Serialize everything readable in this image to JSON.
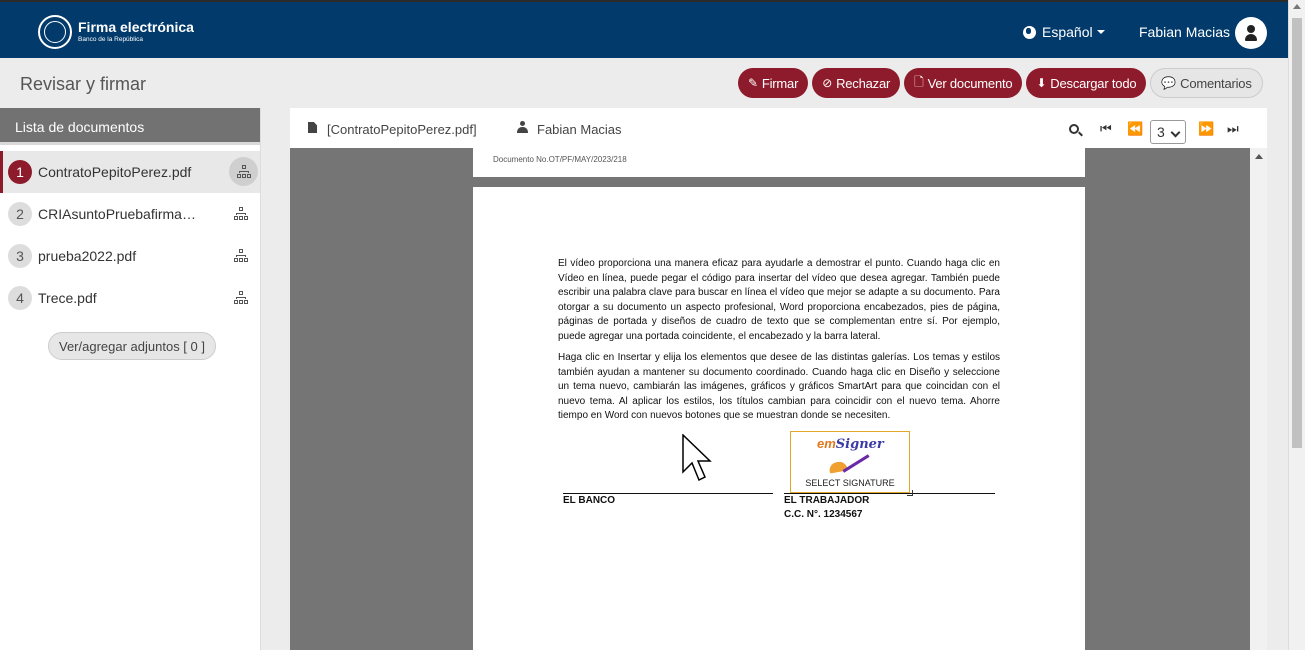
{
  "app": {
    "title": "Firma electrónica",
    "subtitle": "Banco de la República",
    "language": "Español",
    "user": "Fabian Macias"
  },
  "page": {
    "title": "Revisar y firmar"
  },
  "actions": {
    "sign": "Firmar",
    "reject": "Rechazar",
    "view": "Ver documento",
    "download": "Descargar todo",
    "comments": "Comentarios"
  },
  "sidebar": {
    "header": "Lista de documentos",
    "documents": [
      {
        "num": "1",
        "name": "ContratoPepitoPerez.pdf"
      },
      {
        "num": "2",
        "name": "CRIAsuntoPruebafirmaelectronica.pdf"
      },
      {
        "num": "3",
        "name": "prueba2022.pdf"
      },
      {
        "num": "4",
        "name": "Trece.pdf"
      }
    ],
    "attach_button": "Ver/agregar adjuntos [ 0 ]"
  },
  "viewer": {
    "file_name": "[ContratoPepitoPerez.pdf]",
    "user": "Fabian Macias",
    "current_page": "3",
    "prev_page_header": "Documento No.OT/PF/MAY/2023/218",
    "paragraph1": "El vídeo proporciona una manera eficaz para ayudarle a demostrar el punto. Cuando haga clic en Vídeo en línea, puede pegar el código para insertar del vídeo que desea agregar. También puede escribir una palabra clave para buscar en línea el vídeo que mejor se adapte a su documento. Para otorgar a su documento un aspecto profesional, Word proporciona encabezados, pies de página, páginas de portada y diseños de cuadro de texto que se complementan entre sí. Por ejemplo, puede agregar una portada coincidente, el encabezado y la barra lateral.",
    "paragraph2": "Haga clic en Insertar y elija los elementos que desee de las distintas galerías. Los temas y estilos también ayudan a mantener su documento coordinado. Cuando haga clic en Diseño y seleccione un tema nuevo, cambiarán las imágenes, gráficos y gráficos SmartArt para que coincidan con el nuevo tema. Al aplicar los estilos, los títulos cambian para coincidir con el nuevo tema. Ahorre tiempo en Word con nuevos botones que se muestran donde se necesiten.",
    "sig_left_label": "EL BANCO",
    "sig_right_label": "EL TRABAJADOR",
    "sig_right_id": "C.C. N°. 1234567",
    "signer_brand_em": "em",
    "signer_brand_rest": "Signer",
    "signer_select": "SELECT SIGNATURE"
  }
}
